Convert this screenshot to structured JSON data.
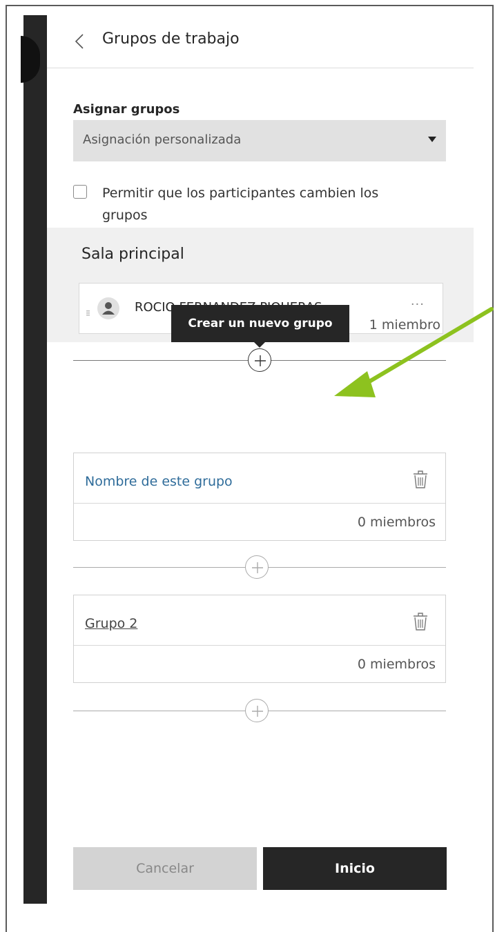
{
  "header": {
    "title": "Grupos de trabajo"
  },
  "assign": {
    "label": "Asignar grupos",
    "selected": "Asignación personalizada"
  },
  "checkbox": {
    "label": "Permitir que los participantes cambien los grupos",
    "checked": false
  },
  "main_room": {
    "title": "Sala principal",
    "member_name": "ROCIO FERNANDEZ PIQUERAS",
    "more_label": "···",
    "member_count": "1 miembro"
  },
  "tooltip": {
    "text": "Crear un nuevo grupo"
  },
  "groups": [
    {
      "name": "Nombre de este grupo",
      "count": "0 miembros"
    },
    {
      "name": "Grupo 2",
      "count": "0 miembros"
    }
  ],
  "buttons": {
    "cancel": "Cancelar",
    "start": "Inicio"
  },
  "colors": {
    "arrow": "#8dc21f",
    "link": "#2f6c9a",
    "dark": "#262626"
  },
  "icons": [
    "back-chevron-icon",
    "dropdown-caret-icon",
    "drag-handle-icon",
    "user-icon",
    "more-options-icon",
    "add-circle-icon",
    "trash-icon"
  ]
}
